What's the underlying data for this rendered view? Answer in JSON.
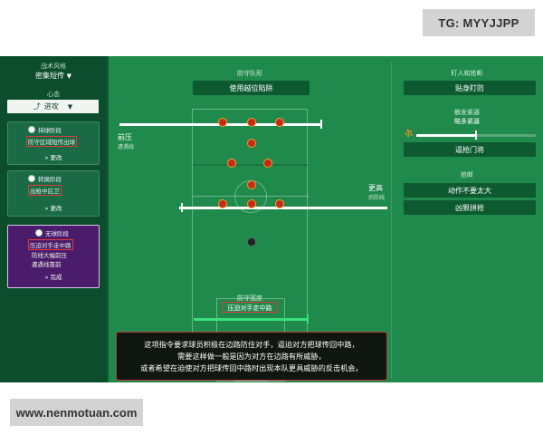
{
  "watermark_top": "TG: MYYJJPP",
  "watermark_bottom": "www.nenmotuan.com",
  "sidebar": {
    "tactic_style_label": "战术风格",
    "tactic_style_value": "密集短传",
    "mentality_label": "心态",
    "mentality_value": "进攻",
    "panels": [
      {
        "title": "持球阶段",
        "line1": "防守区域短传出球",
        "change": "更改"
      },
      {
        "title": "转换阶段",
        "line1": "出枪中后卫",
        "change": "更改"
      },
      {
        "title": "无球阶段",
        "line1": "压迫对手走中路",
        "line2": "防线大幅前压",
        "line3": "遭遇线靠前",
        "done": "完成"
      }
    ]
  },
  "pitch": {
    "header": "防守队形",
    "trap_button": "使用越位陷阱",
    "left_label": "前压",
    "left_sub": "遭遇线",
    "right_label": "更高",
    "right_sub": "后防线",
    "width_header": "防守宽度",
    "width_value": "压迫对手走中路"
  },
  "right_panel": {
    "marking_header": "盯人和抢断",
    "marking_value": "贴身盯防",
    "pressing_header1": "触发紧逼",
    "pressing_header2": "略多紧逼",
    "pressing_button": "逼抢门将",
    "tackle_header": "抢断",
    "tackle_value1": "动作不要太大",
    "tackle_value2": "凶狠拼抢"
  },
  "tooltip": {
    "line1": "这项指令要求球员积极在边路防住对手，逼迫对方把球传回中路，",
    "line2": "需要这样做一般是因为对方在边路有所威胁，",
    "line3": "或者希望在迫使对方把球传回中路时出现本队更具威胁的反击机会。"
  }
}
